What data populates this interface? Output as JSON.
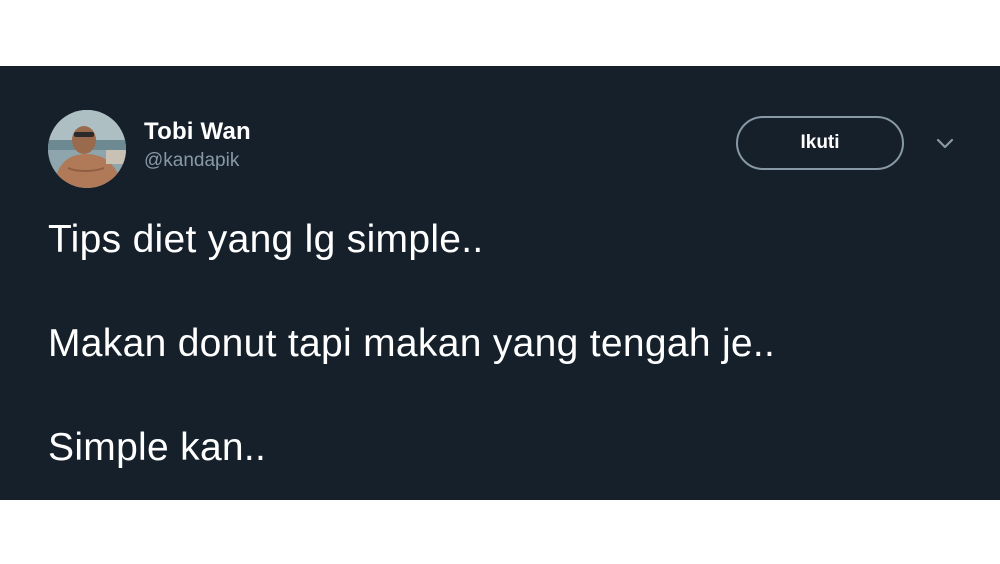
{
  "tweet": {
    "author": {
      "display_name": "Tobi Wan",
      "handle": "@kandapik"
    },
    "follow_label": "Ikuti",
    "menu_icon": "chevron-down-icon",
    "lines": [
      "Tips diet yang lg simple..",
      "Makan donut tapi makan yang tengah je..",
      "Simple kan.."
    ]
  },
  "colors": {
    "card_background": "#15202b",
    "text_primary": "#ffffff",
    "text_secondary": "#8899a6",
    "button_border": "#8899a6"
  }
}
